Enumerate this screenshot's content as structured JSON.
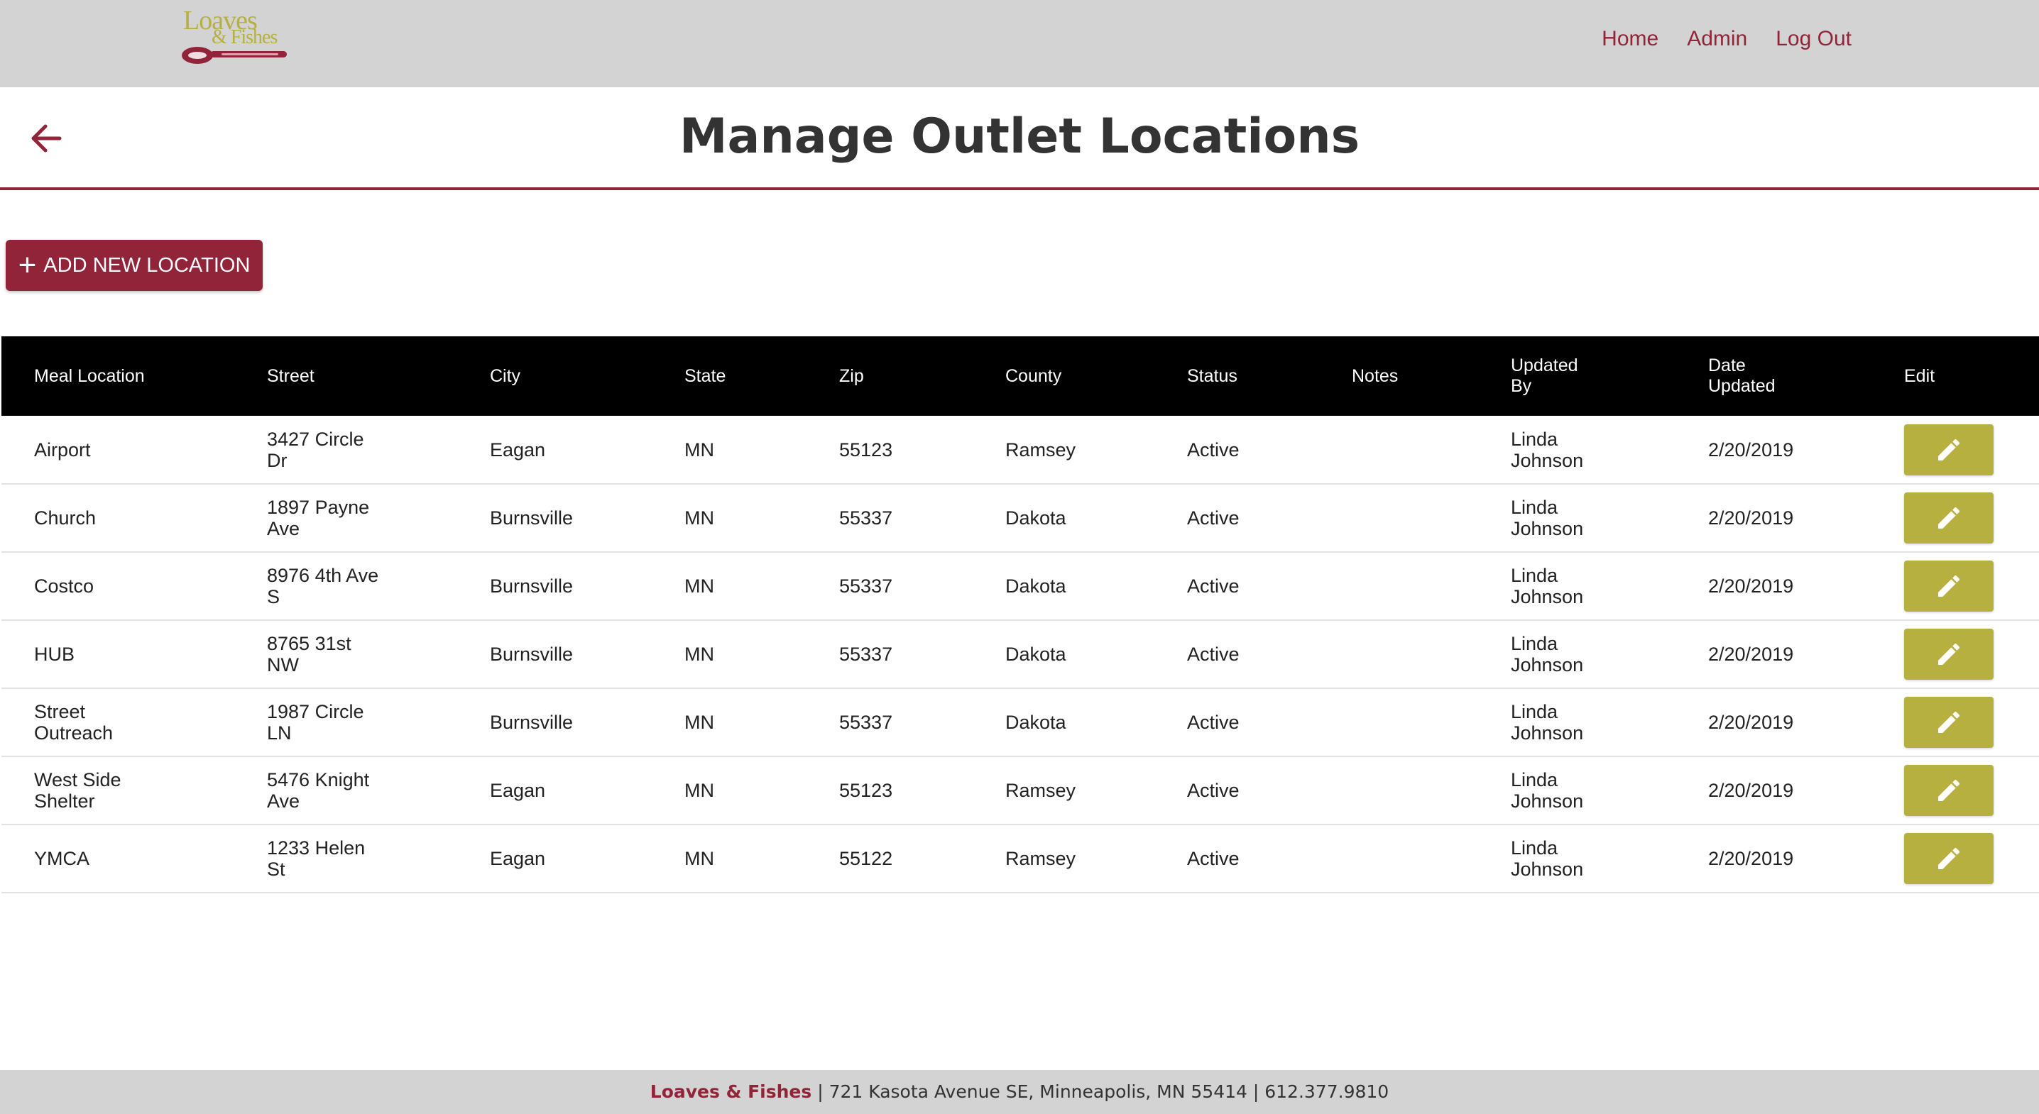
{
  "header": {
    "logo_line1": "Loaves",
    "logo_line2": "& Fishes",
    "nav": [
      "Home",
      "Admin",
      "Log Out"
    ]
  },
  "page": {
    "title": "Manage Outlet Locations",
    "add_button": "ADD NEW LOCATION"
  },
  "table": {
    "headers": [
      "Meal Location",
      "Street",
      "City",
      "State",
      "Zip",
      "County",
      "Status",
      "Notes",
      "Updated\nBy",
      "Date\nUpdated",
      "Edit"
    ],
    "rows": [
      {
        "location": "Airport",
        "street": "3427 Circle\nDr",
        "city": "Eagan",
        "state": "MN",
        "zip": "55123",
        "county": "Ramsey",
        "status": "Active",
        "notes": "",
        "updated_by": "Linda\nJohnson",
        "date": "2/20/2019"
      },
      {
        "location": "Church",
        "street": "1897 Payne\nAve",
        "city": "Burnsville",
        "state": "MN",
        "zip": "55337",
        "county": "Dakota",
        "status": "Active",
        "notes": "",
        "updated_by": "Linda\nJohnson",
        "date": "2/20/2019"
      },
      {
        "location": "Costco",
        "street": "8976 4th Ave\nS",
        "city": "Burnsville",
        "state": "MN",
        "zip": "55337",
        "county": "Dakota",
        "status": "Active",
        "notes": "",
        "updated_by": "Linda\nJohnson",
        "date": "2/20/2019"
      },
      {
        "location": "HUB",
        "street": "8765 31st\nNW",
        "city": "Burnsville",
        "state": "MN",
        "zip": "55337",
        "county": "Dakota",
        "status": "Active",
        "notes": "",
        "updated_by": "Linda\nJohnson",
        "date": "2/20/2019"
      },
      {
        "location": "Street\nOutreach",
        "street": "1987 Circle\nLN",
        "city": "Burnsville",
        "state": "MN",
        "zip": "55337",
        "county": "Dakota",
        "status": "Active",
        "notes": "",
        "updated_by": "Linda\nJohnson",
        "date": "2/20/2019"
      },
      {
        "location": "West Side\nShelter",
        "street": "5476 Knight\nAve",
        "city": "Eagan",
        "state": "MN",
        "zip": "55123",
        "county": "Ramsey",
        "status": "Active",
        "notes": "",
        "updated_by": "Linda\nJohnson",
        "date": "2/20/2019"
      },
      {
        "location": "YMCA",
        "street": "1233 Helen\nSt",
        "city": "Eagan",
        "state": "MN",
        "zip": "55122",
        "county": "Ramsey",
        "status": "Active",
        "notes": "",
        "updated_by": "Linda\nJohnson",
        "date": "2/20/2019"
      }
    ]
  },
  "footer": {
    "brand": "Loaves & Fishes",
    "info": " | 721 Kasota Avenue SE, Minneapolis, MN 55414 | 612.377.9810"
  },
  "icons": {
    "back": "arrow-left-icon",
    "add": "plus-icon",
    "edit": "pencil-icon",
    "logo": "spoon-icon"
  },
  "colors": {
    "brand": "#92243a",
    "accent": "#b6b041",
    "header_bg": "#d3d3d3",
    "table_header_bg": "#000000"
  }
}
